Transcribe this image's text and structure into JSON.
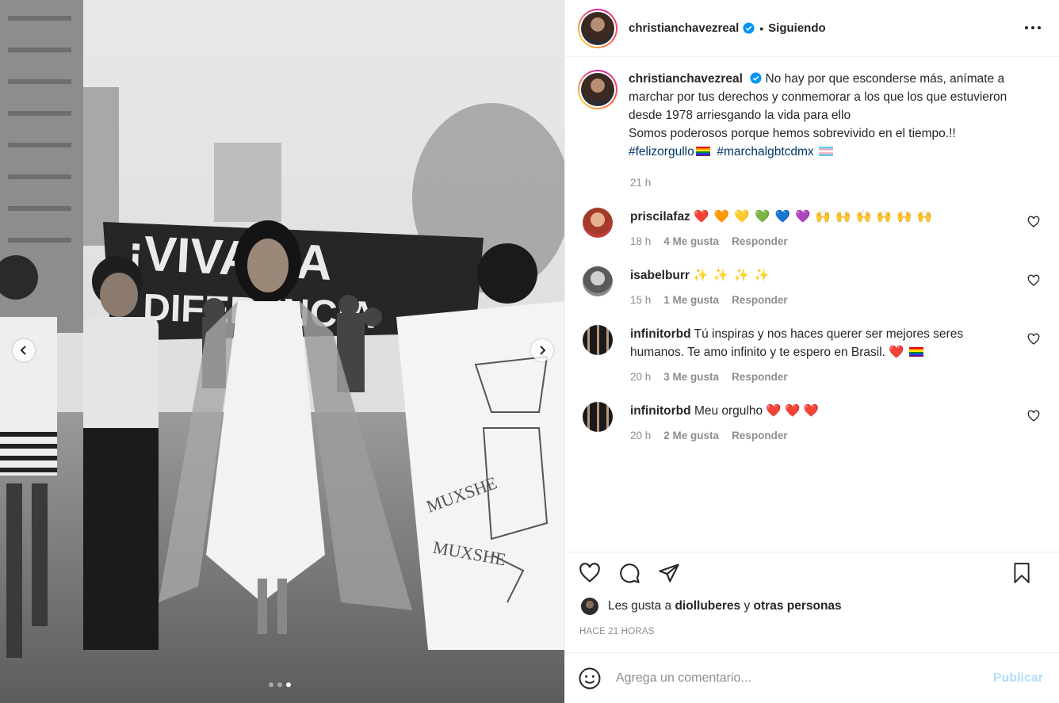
{
  "header": {
    "username": "christianchavezreal",
    "separator": "•",
    "follow_status": "Siguiendo",
    "more_icon": "more-horizontal-icon"
  },
  "caption": {
    "username": "christianchavezreal",
    "text": "No hay por que esconderse más, anímate a marchar por tus derechos y conmemorar a los que los que estuvieron desde 1978 arriesgando la vida para ello",
    "text2": "Somos poderosos porque hemos sobrevivido en el tiempo.!!",
    "hashtag1": "#felizorgullo",
    "hashtag2": "#marchalgbtcdmx",
    "time": "21 h"
  },
  "comments": [
    {
      "username": "priscilafaz",
      "text": "❤️ 🧡 💛 💚 💙 💜 🙌 🙌 🙌 🙌 🙌 🙌",
      "time": "18 h",
      "likes": "4 Me gusta",
      "reply": "Responder"
    },
    {
      "username": "isabelburr",
      "text": "✨ ✨ ✨ ✨",
      "time": "15 h",
      "likes": "1 Me gusta",
      "reply": "Responder"
    },
    {
      "username": "infinitorbd",
      "text": "Tú inspiras y nos haces querer ser mejores seres humanos. Te amo infinito y te espero en Brasil. ❤️",
      "time": "20 h",
      "likes": "3 Me gusta",
      "reply": "Responder"
    },
    {
      "username": "infinitorbd",
      "text": "Meu orgulho ❤️ ❤️ ❤️",
      "time": "20 h",
      "likes": "2 Me gusta",
      "reply": "Responder"
    }
  ],
  "likes": {
    "prefix": "Les gusta a",
    "user": "diolluberes",
    "connector": "y",
    "others": "otras personas"
  },
  "posted_ago": "HACE 21 HORAS",
  "add_comment": {
    "placeholder": "Agrega un comentario...",
    "publish_label": "Publicar"
  },
  "carousel": {
    "current_index": 3,
    "total": 3
  },
  "photo_banner": {
    "line1": "¡VIVA LA",
    "line2": "DIFERENCIA"
  },
  "colors": {
    "accent": "#0095f6",
    "publish_disabled": "#b2dffc",
    "hashtag": "#00376b",
    "muted": "#8e8e8e",
    "heart": "#ed4956"
  }
}
